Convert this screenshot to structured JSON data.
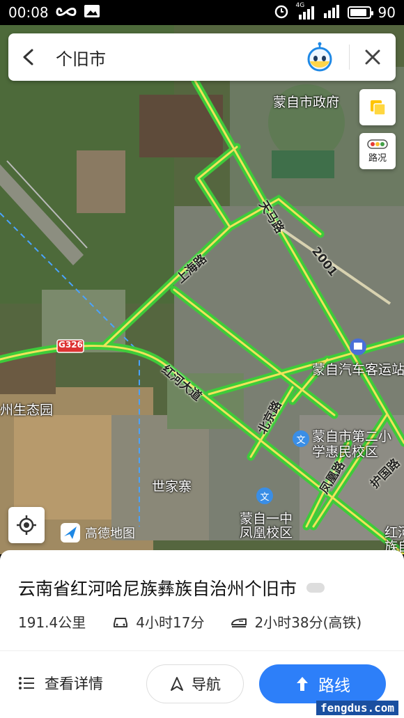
{
  "status_bar": {
    "time": "00:08",
    "network_label": "4G",
    "battery": "90",
    "battery_level": 0.9
  },
  "search_bar": {
    "query": "个旧市"
  },
  "map": {
    "side_buttons": {
      "traffic_label": "路况"
    },
    "places": [
      {
        "name": "蒙自市政府"
      },
      {
        "name": "蒙自汽车客运站"
      },
      {
        "name": "州生态园"
      },
      {
        "name": "蒙自市第二小"
      },
      {
        "name": "学惠民校区"
      },
      {
        "name": "世家寨"
      },
      {
        "name": "蒙自一中"
      },
      {
        "name": "凤凰校区"
      },
      {
        "name": "红河"
      },
      {
        "name": "族自"
      }
    ],
    "roads": [
      {
        "name": "天马路"
      },
      {
        "name": "上海路"
      },
      {
        "name": "红河大道"
      },
      {
        "name": "北京路"
      },
      {
        "name": "凤凰路"
      },
      {
        "name": "护国路"
      },
      {
        "name": "2001"
      },
      {
        "name": "G326"
      }
    ],
    "logo_text": "高德地图"
  },
  "destination": {
    "name": "云南省红河哈尼族彝族自治州个旧市",
    "distance": "191.4公里",
    "drive_time": "4小时17分",
    "train_time": "2小时38分(高铁)"
  },
  "actions": {
    "details": "查看详情",
    "navigate": "导航",
    "route": "路线"
  },
  "watermark": "fengdus.com",
  "colors": {
    "accent": "#2d7ff9",
    "road_green": "#3ecb3a"
  }
}
